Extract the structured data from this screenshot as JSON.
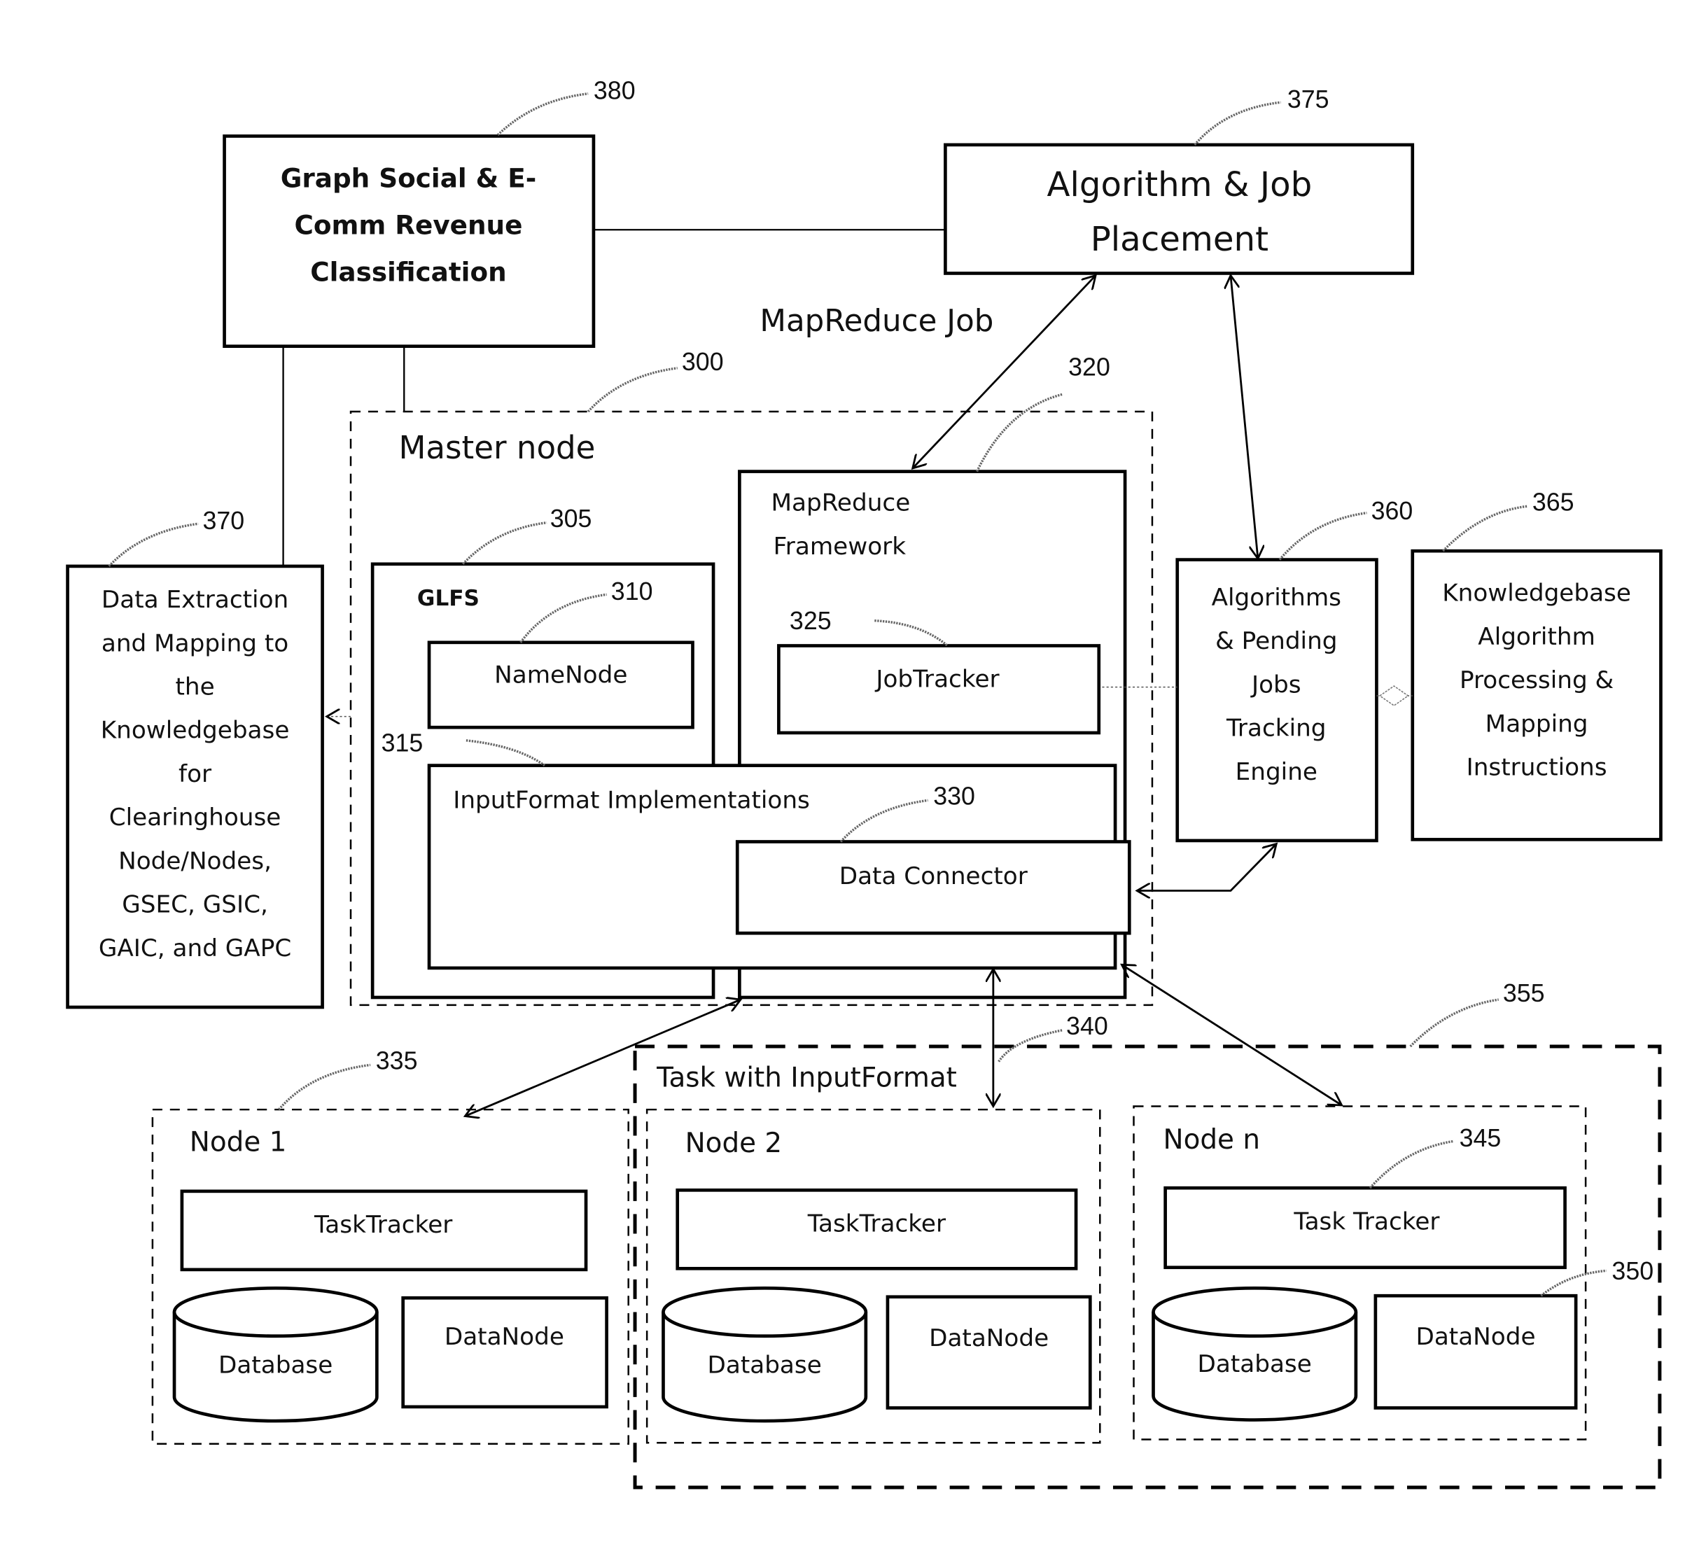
{
  "diagram": {
    "title_label": "MapReduce Job",
    "blocks": {
      "graph_social": {
        "ref": "380",
        "lines": [
          "Graph Social & E-",
          "Comm Revenue",
          "Classification"
        ]
      },
      "algo_job_placement": {
        "ref": "375",
        "lines": [
          "Algorithm & Job",
          "Placement"
        ]
      },
      "data_extraction": {
        "ref": "370",
        "lines": [
          "Data Extraction",
          "and Mapping to",
          "the",
          "Knowledgebase",
          "for",
          "Clearinghouse",
          "Node/Nodes,",
          "GSEC, GSIC,",
          "GAIC, and GAPC"
        ]
      },
      "master_node": {
        "ref": "300",
        "label": "Master node"
      },
      "glfs": {
        "ref": "305",
        "label": "GLFS"
      },
      "namenode": {
        "ref": "310",
        "label": "NameNode"
      },
      "mapreduce_framework": {
        "ref": "320",
        "lines": [
          "MapReduce",
          "Framework"
        ]
      },
      "jobtracker": {
        "ref": "325",
        "label": "JobTracker"
      },
      "inputformat": {
        "ref": "315",
        "label": "InputFormat Implementations"
      },
      "data_connector": {
        "ref": "330",
        "label": "Data Connector"
      },
      "algorithms_pending": {
        "ref": "360",
        "lines": [
          "Algorithms",
          "& Pending",
          "Jobs",
          "Tracking",
          "Engine"
        ]
      },
      "knowledgebase": {
        "ref": "365",
        "lines": [
          "Knowledgebase",
          "Algorithm",
          "Processing &",
          "Mapping",
          "Instructions"
        ]
      },
      "task_group": {
        "ref": "355",
        "label": "Task with InputFormat",
        "arrow_ref": "340"
      },
      "node1": {
        "ref": "335",
        "label": "Node 1",
        "tasktracker": "TaskTracker",
        "database": "Database",
        "datanode": "DataNode"
      },
      "node2": {
        "label": "Node 2",
        "tasktracker": "TaskTracker",
        "database": "Database",
        "datanode": "DataNode"
      },
      "noden": {
        "label": "Node n",
        "tasktracker": "Task Tracker",
        "tasktracker_ref": "345",
        "database": "Database",
        "datanode": "DataNode",
        "datanode_ref": "350"
      }
    }
  }
}
